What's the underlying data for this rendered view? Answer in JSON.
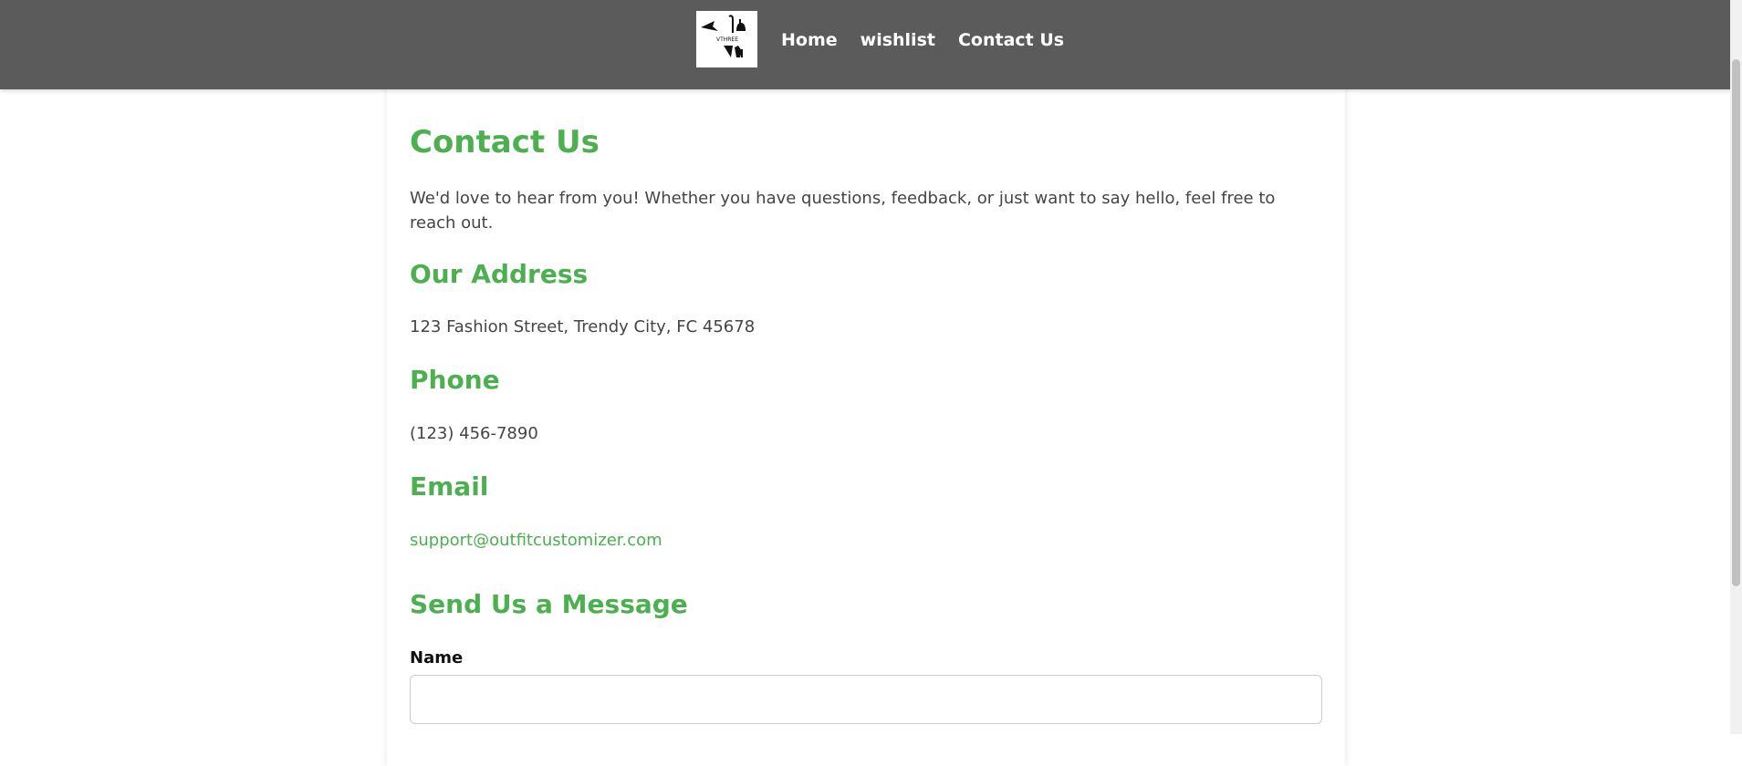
{
  "nav": {
    "logo_text": "VTHREE",
    "links": [
      "Home",
      "wishlist",
      "Contact Us"
    ]
  },
  "contact": {
    "title": "Contact Us",
    "intro": "We'd love to hear from you! Whether you have questions, feedback, or just want to say hello, feel free to reach out.",
    "address_heading": "Our Address",
    "address": "123 Fashion Street, Trendy City, FC 45678",
    "phone_heading": "Phone",
    "phone": "(123) 456-7890",
    "email_heading": "Email",
    "email": "support@outfitcustomizer.com"
  },
  "form": {
    "heading": "Send Us a Message",
    "name_label": "Name",
    "name_value": "",
    "name_placeholder": ""
  },
  "colors": {
    "navbar": "#5b5b5b",
    "accent": "#4caf50",
    "text": "#444444"
  }
}
